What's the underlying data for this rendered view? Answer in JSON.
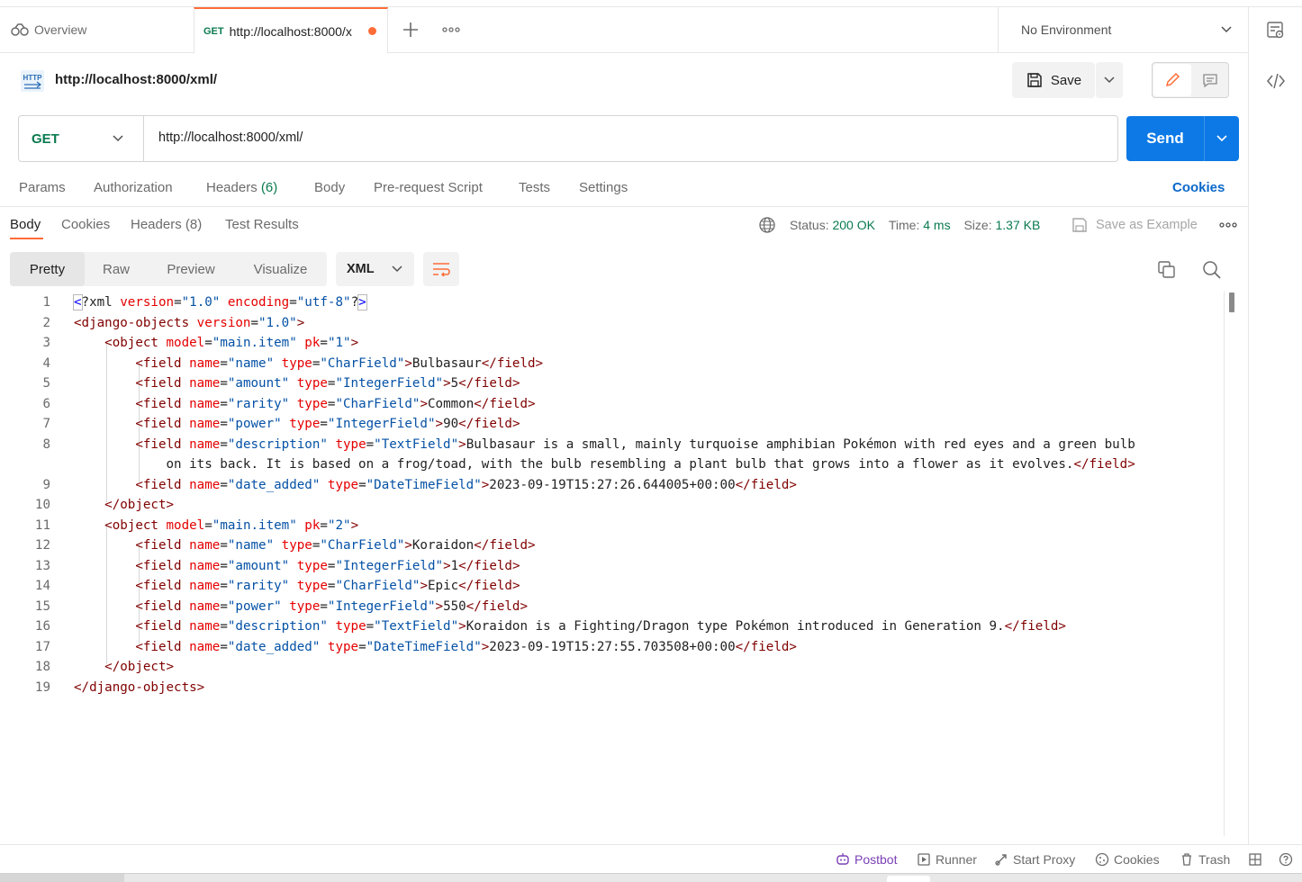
{
  "tabs": [
    {
      "label": "Overview"
    },
    {
      "method": "GET",
      "label": "http://localhost:8000/x"
    }
  ],
  "environment": "No Environment",
  "request": {
    "title": "http://localhost:8000/xml/",
    "method": "GET",
    "url": "http://localhost:8000/xml/",
    "save_label": "Save",
    "send_label": "Send"
  },
  "request_tabs": [
    "Params",
    "Authorization",
    "Headers",
    "(6)",
    "Body",
    "Pre-request Script",
    "Tests",
    "Settings"
  ],
  "cookies_link": "Cookies",
  "response_tabs": [
    "Body",
    "Cookies",
    "Headers",
    "(8)",
    "Test Results"
  ],
  "response_status": {
    "status_label": "Status:",
    "status": "200 OK",
    "time_label": "Time:",
    "time": "4 ms",
    "size_label": "Size:",
    "size": "1.37 KB",
    "save_example": "Save as Example"
  },
  "view_modes": [
    "Pretty",
    "Raw",
    "Preview",
    "Visualize"
  ],
  "format": "XML",
  "line_numbers": [
    "1",
    "2",
    "3",
    "4",
    "5",
    "6",
    "7",
    "8",
    "",
    "9",
    "10",
    "11",
    "12",
    "13",
    "14",
    "15",
    "16",
    "17",
    "18",
    "19"
  ],
  "status_bar": [
    "Postbot",
    "Runner",
    "Start Proxy",
    "Cookies",
    "Trash"
  ],
  "colors": {
    "accent": "#ff6c37",
    "send": "#0c79e6",
    "green": "#0a7a4f",
    "link": "#0c69c9"
  }
}
